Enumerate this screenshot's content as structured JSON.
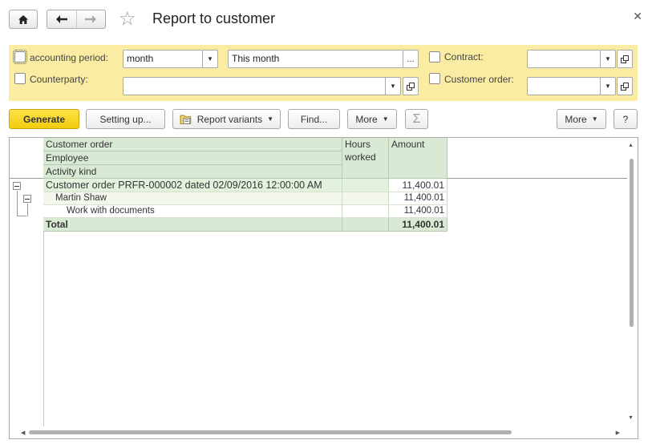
{
  "window": {
    "title": "Report to customer",
    "close_icon": "close-icon"
  },
  "nav": {
    "home_icon": "home-icon",
    "back_icon": "arrow-left-icon",
    "forward_icon": "arrow-right-icon",
    "favorite_icon": "star-icon"
  },
  "filters": {
    "accounting_period": {
      "label": "accounting period:",
      "checked": false,
      "period_kind": "month",
      "period_value": "This month",
      "select_label": "..."
    },
    "counterparty": {
      "label": "Counterparty:",
      "checked": false,
      "value": ""
    },
    "contract": {
      "label": "Contract:",
      "checked": false,
      "value": ""
    },
    "customer_order": {
      "label": "Customer order:",
      "checked": false,
      "value": ""
    }
  },
  "toolbar": {
    "generate": "Generate",
    "setting_up": "Setting up...",
    "report_variants": "Report variants",
    "find": "Find...",
    "more": "More",
    "sum_icon": "sigma-icon",
    "more_right": "More",
    "help": "?"
  },
  "report": {
    "headers": {
      "group_1": "Customer order",
      "group_2": "Employee",
      "group_3": "Activity kind",
      "hours": "Hours worked",
      "amount": "Amount"
    },
    "rows": [
      {
        "level": 1,
        "label": "Customer order PRFR-000002 dated 02/09/2016 12:00:00 AM",
        "hours": "",
        "amount": "11,400.01"
      },
      {
        "level": 2,
        "label": "Martin Shaw",
        "hours": "",
        "amount": "11,400.01"
      },
      {
        "level": 3,
        "label": "Work with documents",
        "hours": "",
        "amount": "11,400.01"
      }
    ],
    "total": {
      "label": "Total",
      "hours": "",
      "amount": "11,400.01"
    }
  },
  "colors": {
    "filter_panel": "#fbeca3",
    "generate_button": "#f2cc0c",
    "header_fill": "#d8ead3",
    "group_row_fill": "#e3f2dd",
    "total_fill": "#d8ead3"
  }
}
